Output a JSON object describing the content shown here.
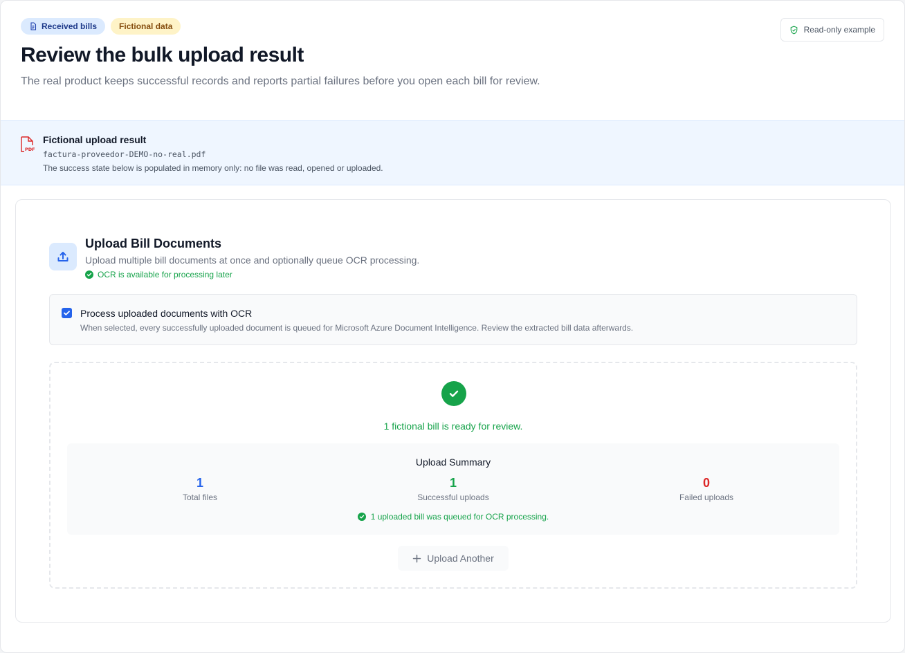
{
  "header": {
    "badges": [
      {
        "label": "Received bills",
        "icon": "document-icon"
      },
      {
        "label": "Fictional data"
      }
    ],
    "title": "Review the bulk upload result",
    "description": "The real product keeps successful records and reports partial failures before you open each bill for review.",
    "readonly_label": "Read-only example"
  },
  "banner": {
    "icon": "pdf-icon",
    "title": "Fictional upload result",
    "file_name": "factura-proveedor-DEMO-no-real.pdf",
    "note": "The success state below is populated in memory only: no file was read, opened or uploaded."
  },
  "upload": {
    "title": "Upload Bill Documents",
    "subtitle": "Upload multiple bill documents at once and optionally queue OCR processing.",
    "ocr_status": "OCR is available for processing later",
    "ocr_option": {
      "checked": true,
      "label": "Process uploaded documents with OCR",
      "help": "When selected, every successfully uploaded document is queued for Microsoft Azure Document Intelligence. Review the extracted bill data afterwards."
    },
    "result": {
      "message": "1 fictional bill is ready for review.",
      "summary_title": "Upload Summary",
      "stats": [
        {
          "value": "1",
          "label": "Total files"
        },
        {
          "value": "1",
          "label": "Successful uploads"
        },
        {
          "value": "0",
          "label": "Failed uploads"
        }
      ],
      "queued_message": "1 uploaded bill was queued for OCR processing.",
      "upload_another_label": "Upload Another"
    }
  },
  "colors": {
    "primary": "#2563eb",
    "success": "#16a34a",
    "danger": "#dc2626",
    "banner_bg": "#eff6ff",
    "badge_blue_bg": "#dbeafe",
    "badge_yellow_bg": "#fef3c7"
  }
}
